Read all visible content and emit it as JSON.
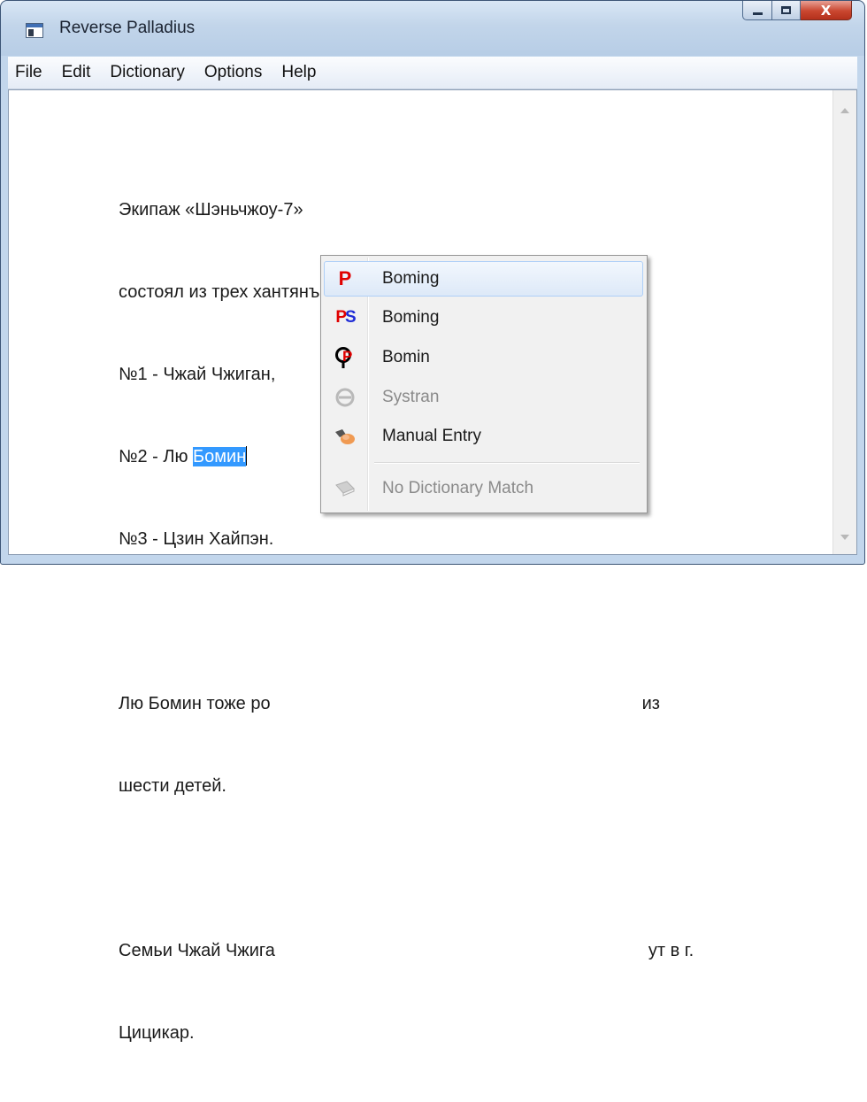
{
  "window": {
    "title": "Reverse Palladius",
    "close_glyph": "X"
  },
  "menubar": {
    "items": [
      "File",
      "Edit",
      "Dictionary",
      "Options",
      "Help"
    ]
  },
  "document": {
    "line1": "Экипаж «Шэньчжоу-7»",
    "line2": "состоял из трех хантянъюаней (космонавтов):",
    "line3": "№1 - Чжай Чжиган,",
    "line4_prefix": "№2 - Лю ",
    "line4_selected": "Бомин",
    "line5": "№3 - Цзин Хайпэн.",
    "line6_left": "Лю Бомин тоже ро",
    "line6_right": "из",
    "line7": "шести детей.",
    "line8_left": "Семьи Чжай Чжига",
    "line8_right": "ут в г.",
    "line9": "Цицикар."
  },
  "context_menu": {
    "items": [
      {
        "label": "Boming",
        "icon": "palladius-p-icon",
        "glyph": "P",
        "highlighted": true,
        "disabled": false
      },
      {
        "label": "Boming",
        "icon": "palladius-ps-icon",
        "glyph": "PS",
        "highlighted": false,
        "disabled": false
      },
      {
        "label": "Bomin",
        "icon": "pinyin-p-icon",
        "glyph": "P",
        "highlighted": false,
        "disabled": false
      },
      {
        "label": "Systran",
        "icon": "systran-icon",
        "highlighted": false,
        "disabled": true
      },
      {
        "label": "Manual Entry",
        "icon": "hand-edit-icon",
        "highlighted": false,
        "disabled": false
      },
      {
        "label": "No Dictionary Match",
        "icon": "book-icon",
        "highlighted": false,
        "disabled": true
      }
    ]
  },
  "colors": {
    "selection": "#3399ff",
    "highlight_border": "#aecff7",
    "icon_red": "#e00000",
    "icon_blue": "#1e2bd6"
  }
}
